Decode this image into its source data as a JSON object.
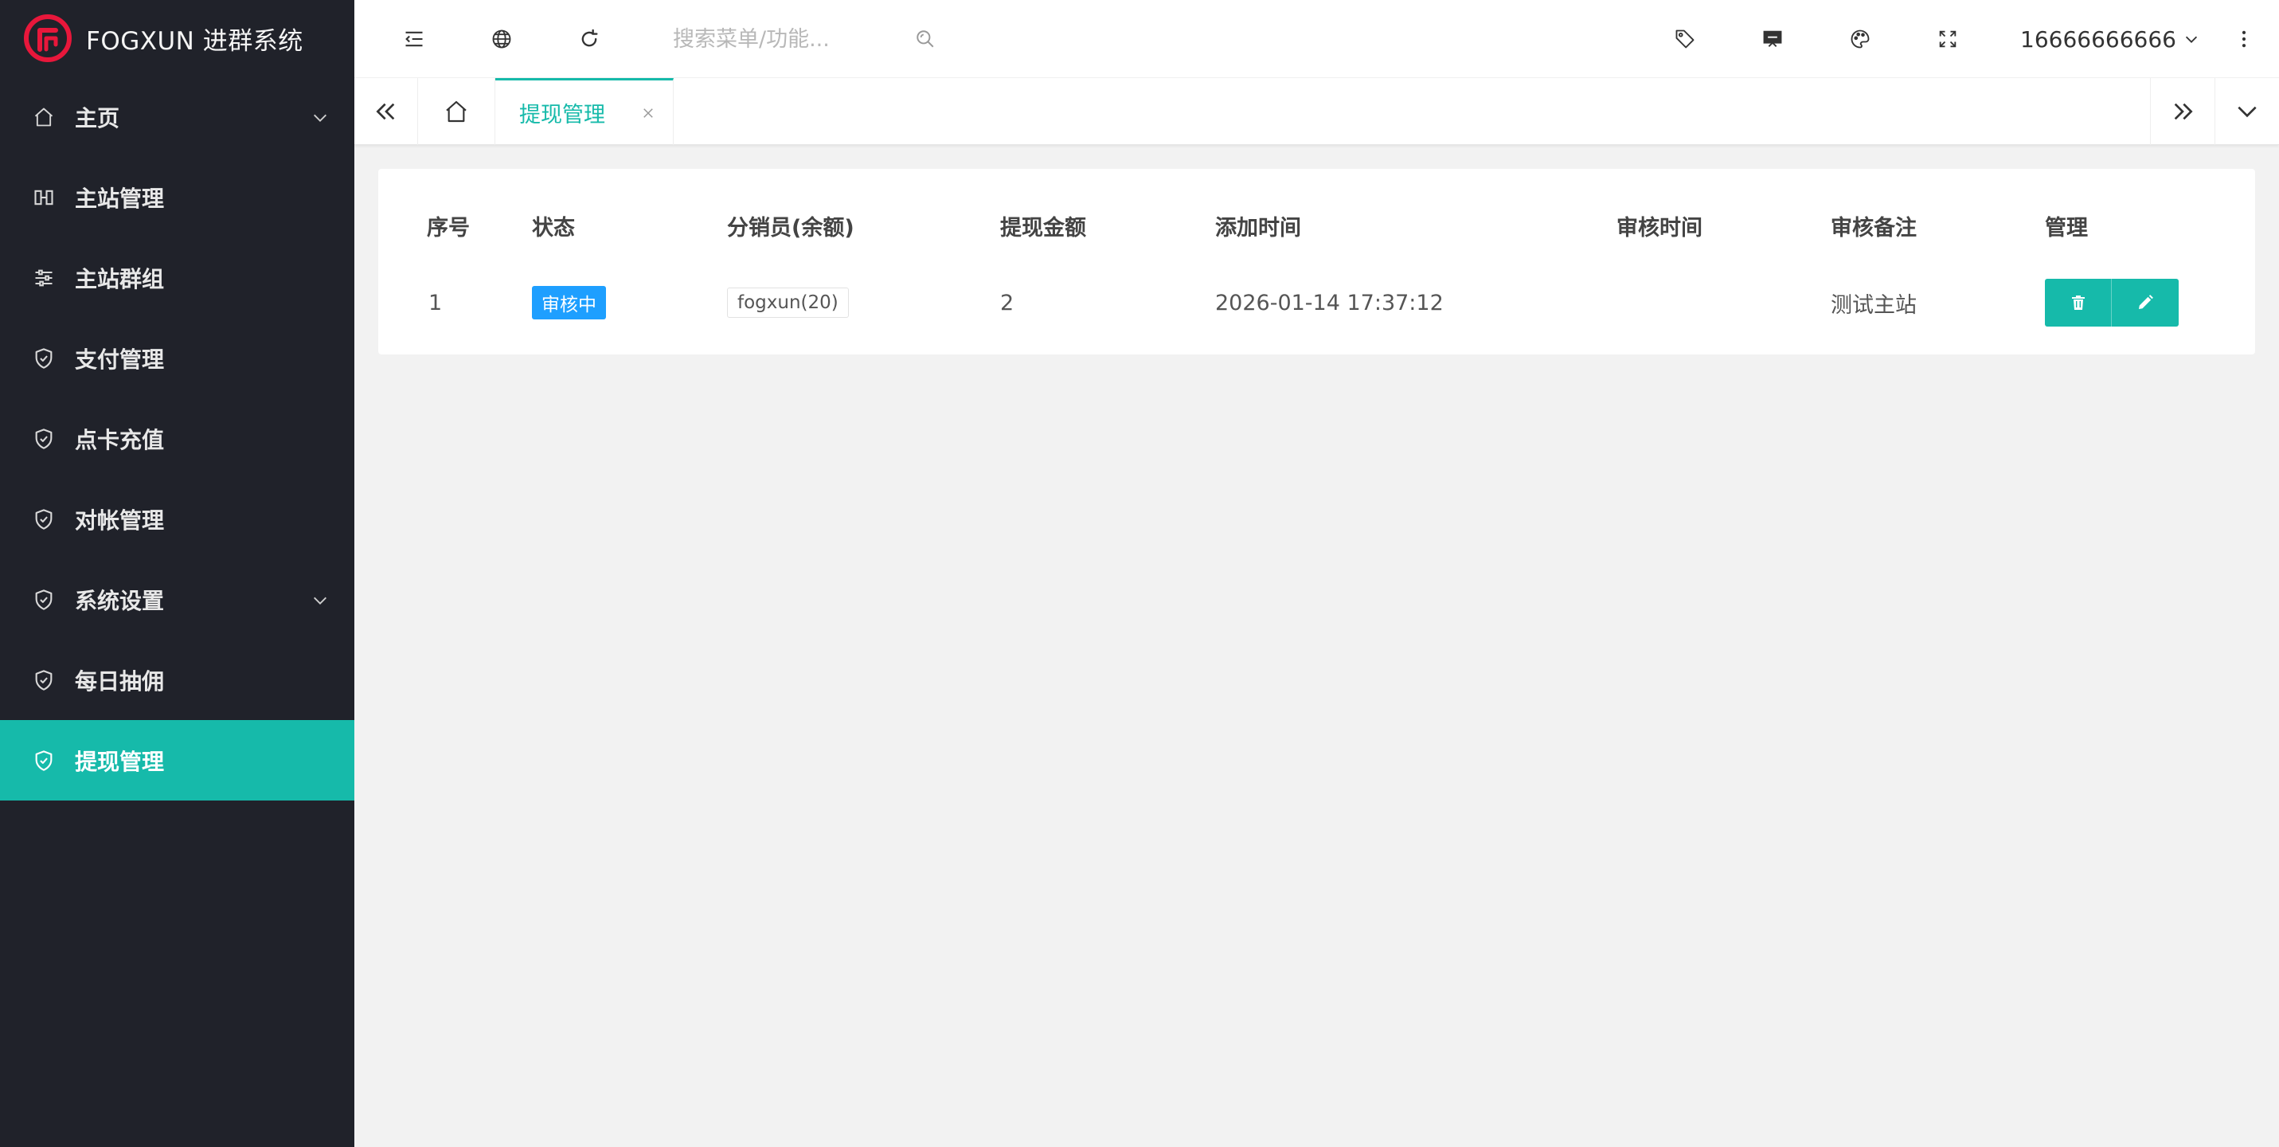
{
  "app": {
    "logo_text": "FOGXUN 进群系统"
  },
  "sidebar": {
    "items": [
      {
        "label": "主页",
        "icon": "home-icon",
        "has_arrow": true
      },
      {
        "label": "主站管理",
        "icon": "columns-icon",
        "has_arrow": false
      },
      {
        "label": "主站群组",
        "icon": "sliders-icon",
        "has_arrow": false
      },
      {
        "label": "支付管理",
        "icon": "shield-check-icon",
        "has_arrow": false
      },
      {
        "label": "点卡充值",
        "icon": "shield-check-icon",
        "has_arrow": false
      },
      {
        "label": "对帐管理",
        "icon": "shield-check-icon",
        "has_arrow": false
      },
      {
        "label": "系统设置",
        "icon": "shield-check-icon",
        "has_arrow": true
      },
      {
        "label": "每日抽佣",
        "icon": "shield-check-icon",
        "has_arrow": false
      },
      {
        "label": "提现管理",
        "icon": "shield-check-icon",
        "has_arrow": false,
        "active": true
      }
    ]
  },
  "header": {
    "search_placeholder": "搜索菜单/功能...",
    "user_name": "16666666666"
  },
  "tabs": {
    "active_label": "提现管理"
  },
  "table": {
    "columns": [
      "序号",
      "状态",
      "分销员(余额)",
      "提现金额",
      "添加时间",
      "审核时间",
      "审核备注",
      "管理"
    ],
    "rows": [
      {
        "index": "1",
        "status": "审核中",
        "distributor": "fogxun(20)",
        "amount": "2",
        "added_time": "2026-01-14 17:37:12",
        "review_time": "",
        "review_note": "测试主站"
      }
    ]
  },
  "colors": {
    "sidebar_bg": "#20222a",
    "accent": "#16baaa",
    "badge_blue": "#1e9fff",
    "logo_red": "#e8173b"
  }
}
